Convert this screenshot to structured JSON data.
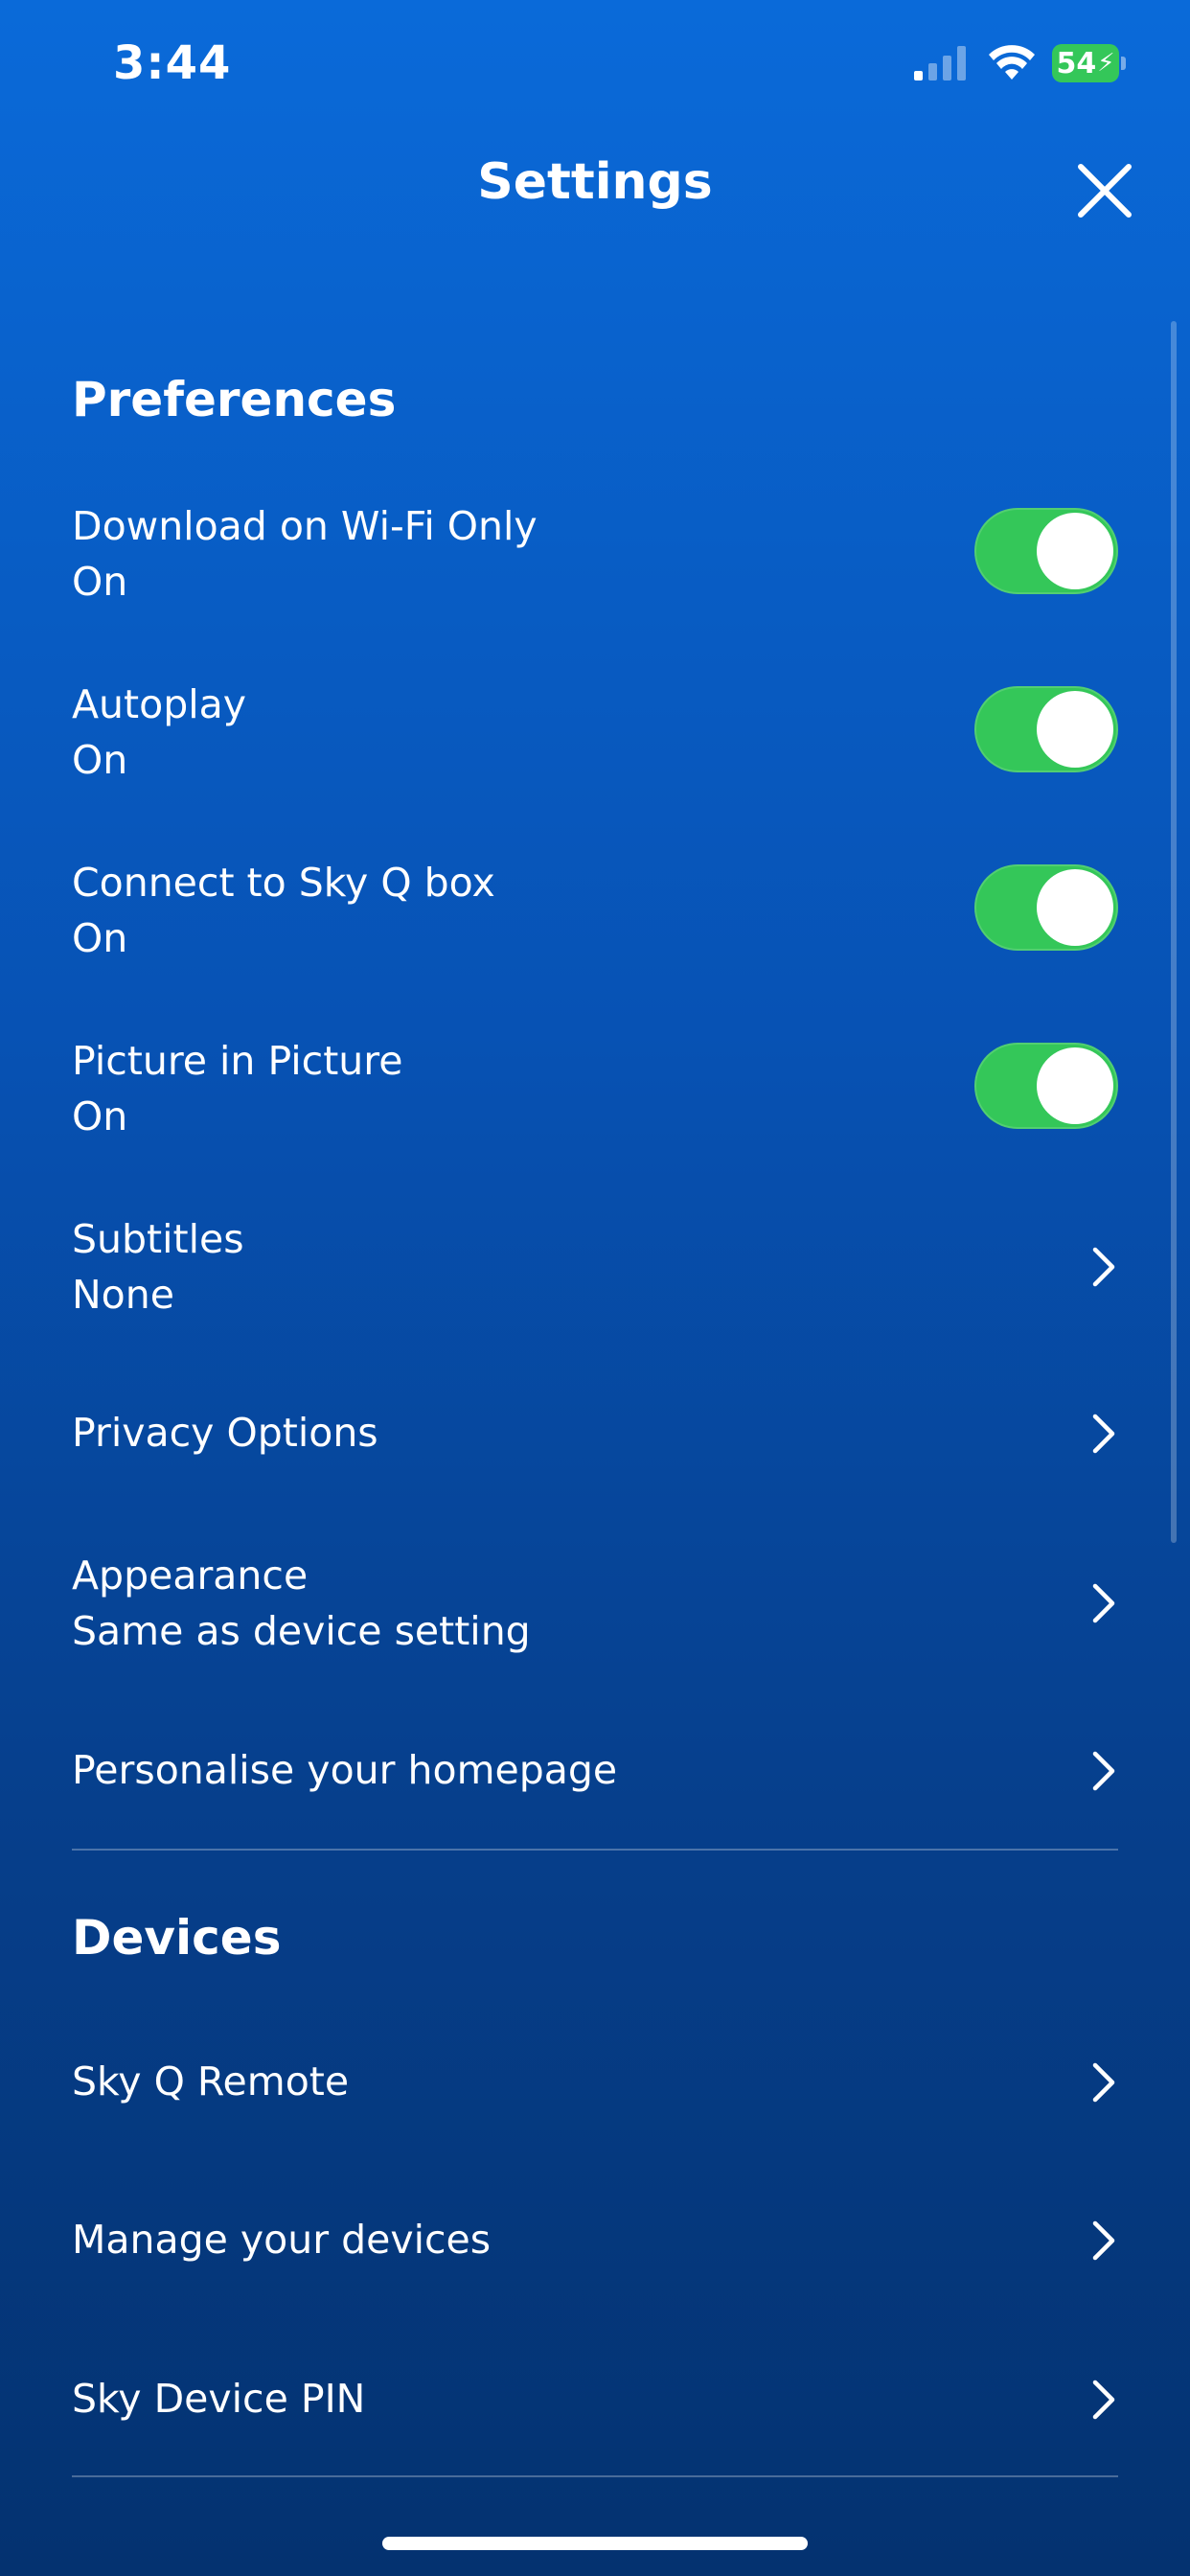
{
  "status_bar": {
    "time": "3:44",
    "battery_level": "54",
    "icons": [
      "signal-icon",
      "wifi-icon",
      "battery-charging-icon"
    ]
  },
  "header": {
    "title": "Settings",
    "close_icon": "close-icon"
  },
  "preferences": {
    "title": "Preferences",
    "items": [
      {
        "label": "Download on Wi-Fi Only",
        "value": "On",
        "control": "toggle",
        "on": true
      },
      {
        "label": "Autoplay",
        "value": "On",
        "control": "toggle",
        "on": true
      },
      {
        "label": "Connect to Sky Q box",
        "value": "On",
        "control": "toggle",
        "on": true
      },
      {
        "label": "Picture in Picture",
        "value": "On",
        "control": "toggle",
        "on": true
      },
      {
        "label": "Subtitles",
        "value": "None",
        "control": "chevron"
      },
      {
        "label": "Privacy Options",
        "control": "chevron"
      },
      {
        "label": "Appearance",
        "value": "Same as device setting",
        "control": "chevron"
      },
      {
        "label": "Personalise your homepage",
        "control": "chevron"
      }
    ]
  },
  "devices": {
    "title": "Devices",
    "items": [
      {
        "label": "Sky Q Remote",
        "control": "chevron"
      },
      {
        "label": "Manage your devices",
        "control": "chevron"
      },
      {
        "label": "Sky Device PIN",
        "control": "chevron"
      }
    ]
  },
  "colors": {
    "toggle_on": "#34c759",
    "background_top": "#0a6ad9",
    "background_bottom": "#043270"
  }
}
